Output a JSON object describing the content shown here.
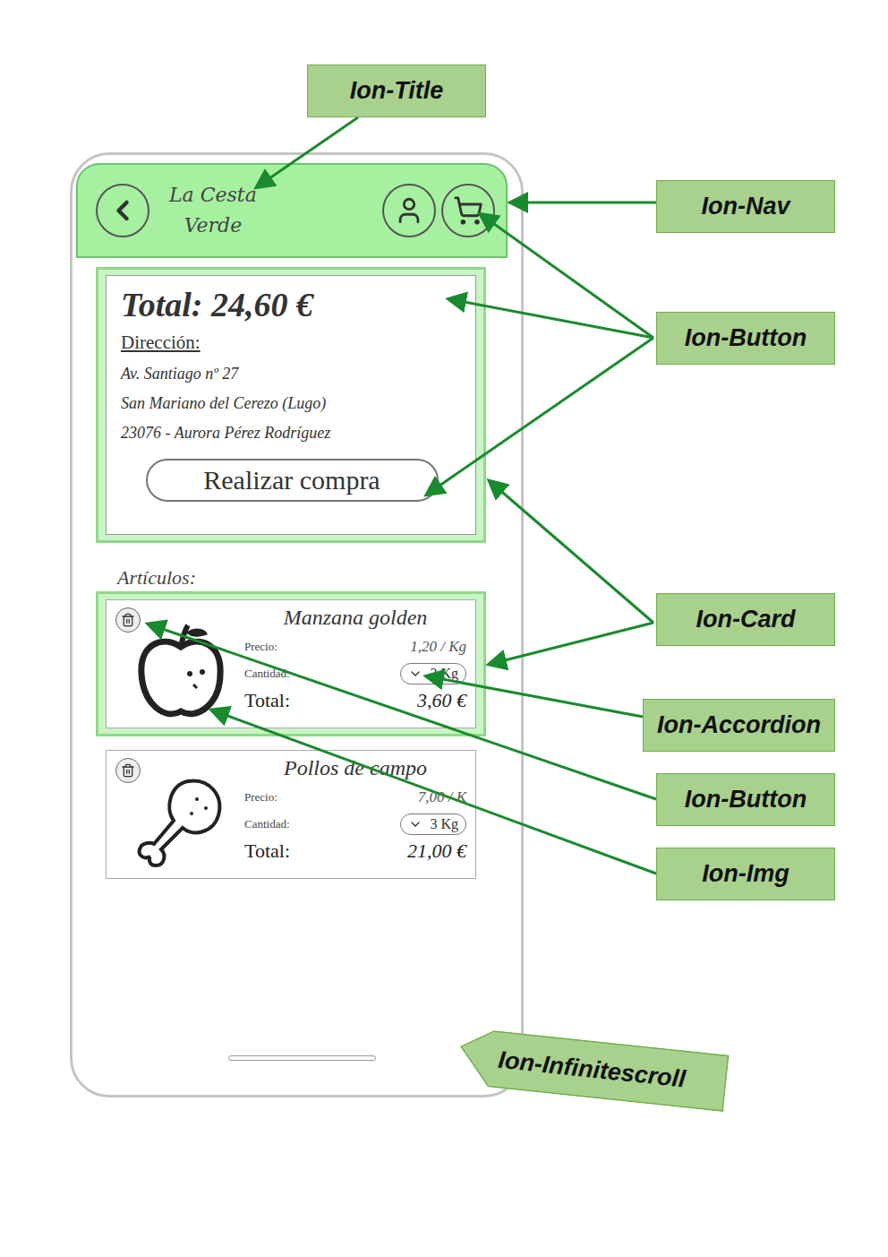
{
  "header": {
    "title_lines": [
      "La Cesta",
      "Verde"
    ]
  },
  "summary": {
    "total": "Total: 24,60 €",
    "address_label": "Dirección:",
    "address_lines": [
      "Av. Santiago nº 27",
      "San Mariano del Cerezo (Lugo)",
      "23076 - Aurora Pérez Rodríguez"
    ],
    "button": "Realizar compra"
  },
  "articles": {
    "label": "Artículos:",
    "items": [
      {
        "name": "Manzana golden",
        "kind": "apple",
        "highlighted": true,
        "price_label": "Precio:",
        "price": "1,20 / Kg",
        "quantity_label": "Cantidad:",
        "quantity": "3 Kg",
        "total_label": "Total:",
        "total": "3,60 €"
      },
      {
        "name": "Pollos de campo",
        "kind": "chicken",
        "highlighted": false,
        "price_label": "Precio:",
        "price": "7,00 / K",
        "quantity_label": "Cantidad:",
        "quantity": "3 Kg",
        "total_label": "Total:",
        "total": "21,00 €"
      }
    ]
  },
  "annotations": [
    {
      "text": "Ion-Title"
    },
    {
      "text": "Ion-Nav"
    },
    {
      "text": "Ion-Button"
    },
    {
      "text": "Ion-Card"
    },
    {
      "text": "Ion-Accordion"
    },
    {
      "text": "Ion-Button"
    },
    {
      "text": "Ion-Img"
    },
    {
      "text": "Ion-Infinitescroll"
    }
  ]
}
